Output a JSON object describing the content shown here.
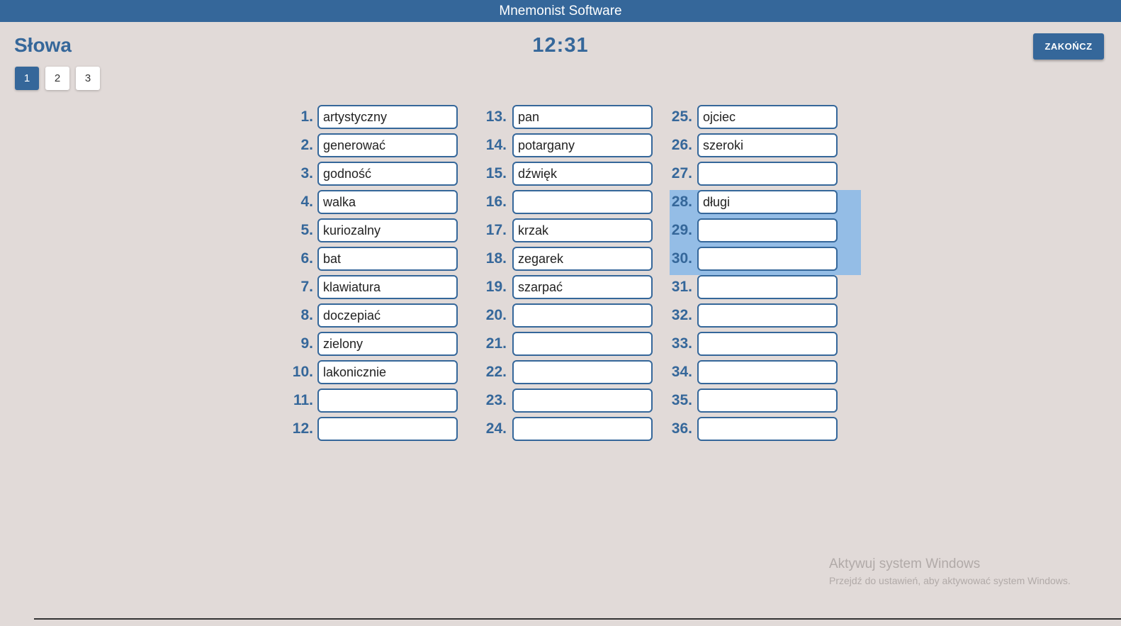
{
  "app": {
    "title": "Mnemonist Software"
  },
  "header": {
    "title": "Słowa",
    "timer": "12:31",
    "finish_label": "ZAKOŃCZ"
  },
  "pagination": [
    "1",
    "2",
    "3"
  ],
  "columns": [
    {
      "rows": [
        {
          "num": "1.",
          "value": "artystyczny"
        },
        {
          "num": "2.",
          "value": "generować"
        },
        {
          "num": "3.",
          "value": "godność"
        },
        {
          "num": "4.",
          "value": "walka"
        },
        {
          "num": "5.",
          "value": "kuriozalny"
        },
        {
          "num": "6.",
          "value": "bat"
        },
        {
          "num": "7.",
          "value": "klawiatura"
        },
        {
          "num": "8.",
          "value": "doczepiać"
        },
        {
          "num": "9.",
          "value": "zielony"
        },
        {
          "num": "10.",
          "value": "lakonicznie"
        },
        {
          "num": "11.",
          "value": ""
        },
        {
          "num": "12.",
          "value": ""
        }
      ]
    },
    {
      "rows": [
        {
          "num": "13.",
          "value": "pan"
        },
        {
          "num": "14.",
          "value": "potargany"
        },
        {
          "num": "15.",
          "value": "dźwięk"
        },
        {
          "num": "16.",
          "value": ""
        },
        {
          "num": "17.",
          "value": "krzak"
        },
        {
          "num": "18.",
          "value": "zegarek"
        },
        {
          "num": "19.",
          "value": "szarpać"
        },
        {
          "num": "20.",
          "value": ""
        },
        {
          "num": "21.",
          "value": ""
        },
        {
          "num": "22.",
          "value": ""
        },
        {
          "num": "23.",
          "value": ""
        },
        {
          "num": "24.",
          "value": ""
        }
      ]
    },
    {
      "rows": [
        {
          "num": "25.",
          "value": "ojciec"
        },
        {
          "num": "26.",
          "value": "szeroki"
        },
        {
          "num": "27.",
          "value": ""
        },
        {
          "num": "28.",
          "value": "długi"
        },
        {
          "num": "29.",
          "value": ""
        },
        {
          "num": "30.",
          "value": ""
        },
        {
          "num": "31.",
          "value": ""
        },
        {
          "num": "32.",
          "value": ""
        },
        {
          "num": "33.",
          "value": ""
        },
        {
          "num": "34.",
          "value": ""
        },
        {
          "num": "35.",
          "value": ""
        },
        {
          "num": "36.",
          "value": ""
        }
      ]
    }
  ],
  "watermark": {
    "title": "Aktywuj system Windows",
    "subtitle": "Przejdź do ustawień, aby aktywować system Windows."
  },
  "colors": {
    "accent": "#35679a",
    "background": "#e1dad8",
    "highlight": "#94bde6"
  }
}
